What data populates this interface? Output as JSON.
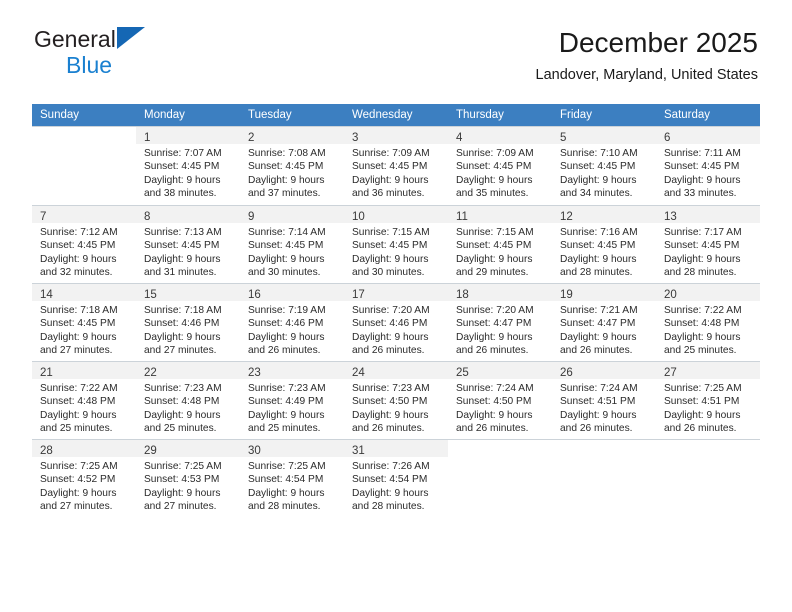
{
  "brand": {
    "name_top": "General",
    "name_bottom": "Blue",
    "triangle_color": "#1567b4",
    "bottom_color": "#1a80d0"
  },
  "header": {
    "title": "December 2025",
    "subtitle": "Landover, Maryland, United States"
  },
  "theme": {
    "header_row_bg": "#3c7fc1",
    "header_row_text": "#ffffff",
    "daynum_bar_bg": "#f2f2f2",
    "grid_line": "#ccd3d9"
  },
  "weekdays": [
    "Sunday",
    "Monday",
    "Tuesday",
    "Wednesday",
    "Thursday",
    "Friday",
    "Saturday"
  ],
  "weeks": [
    [
      {
        "day": "",
        "sunrise": "",
        "sunset": "",
        "daylight_line1": "",
        "daylight_line2": ""
      },
      {
        "day": "1",
        "sunrise": "Sunrise: 7:07 AM",
        "sunset": "Sunset: 4:45 PM",
        "daylight_line1": "Daylight: 9 hours",
        "daylight_line2": "and 38 minutes."
      },
      {
        "day": "2",
        "sunrise": "Sunrise: 7:08 AM",
        "sunset": "Sunset: 4:45 PM",
        "daylight_line1": "Daylight: 9 hours",
        "daylight_line2": "and 37 minutes."
      },
      {
        "day": "3",
        "sunrise": "Sunrise: 7:09 AM",
        "sunset": "Sunset: 4:45 PM",
        "daylight_line1": "Daylight: 9 hours",
        "daylight_line2": "and 36 minutes."
      },
      {
        "day": "4",
        "sunrise": "Sunrise: 7:09 AM",
        "sunset": "Sunset: 4:45 PM",
        "daylight_line1": "Daylight: 9 hours",
        "daylight_line2": "and 35 minutes."
      },
      {
        "day": "5",
        "sunrise": "Sunrise: 7:10 AM",
        "sunset": "Sunset: 4:45 PM",
        "daylight_line1": "Daylight: 9 hours",
        "daylight_line2": "and 34 minutes."
      },
      {
        "day": "6",
        "sunrise": "Sunrise: 7:11 AM",
        "sunset": "Sunset: 4:45 PM",
        "daylight_line1": "Daylight: 9 hours",
        "daylight_line2": "and 33 minutes."
      }
    ],
    [
      {
        "day": "7",
        "sunrise": "Sunrise: 7:12 AM",
        "sunset": "Sunset: 4:45 PM",
        "daylight_line1": "Daylight: 9 hours",
        "daylight_line2": "and 32 minutes."
      },
      {
        "day": "8",
        "sunrise": "Sunrise: 7:13 AM",
        "sunset": "Sunset: 4:45 PM",
        "daylight_line1": "Daylight: 9 hours",
        "daylight_line2": "and 31 minutes."
      },
      {
        "day": "9",
        "sunrise": "Sunrise: 7:14 AM",
        "sunset": "Sunset: 4:45 PM",
        "daylight_line1": "Daylight: 9 hours",
        "daylight_line2": "and 30 minutes."
      },
      {
        "day": "10",
        "sunrise": "Sunrise: 7:15 AM",
        "sunset": "Sunset: 4:45 PM",
        "daylight_line1": "Daylight: 9 hours",
        "daylight_line2": "and 30 minutes."
      },
      {
        "day": "11",
        "sunrise": "Sunrise: 7:15 AM",
        "sunset": "Sunset: 4:45 PM",
        "daylight_line1": "Daylight: 9 hours",
        "daylight_line2": "and 29 minutes."
      },
      {
        "day": "12",
        "sunrise": "Sunrise: 7:16 AM",
        "sunset": "Sunset: 4:45 PM",
        "daylight_line1": "Daylight: 9 hours",
        "daylight_line2": "and 28 minutes."
      },
      {
        "day": "13",
        "sunrise": "Sunrise: 7:17 AM",
        "sunset": "Sunset: 4:45 PM",
        "daylight_line1": "Daylight: 9 hours",
        "daylight_line2": "and 28 minutes."
      }
    ],
    [
      {
        "day": "14",
        "sunrise": "Sunrise: 7:18 AM",
        "sunset": "Sunset: 4:45 PM",
        "daylight_line1": "Daylight: 9 hours",
        "daylight_line2": "and 27 minutes."
      },
      {
        "day": "15",
        "sunrise": "Sunrise: 7:18 AM",
        "sunset": "Sunset: 4:46 PM",
        "daylight_line1": "Daylight: 9 hours",
        "daylight_line2": "and 27 minutes."
      },
      {
        "day": "16",
        "sunrise": "Sunrise: 7:19 AM",
        "sunset": "Sunset: 4:46 PM",
        "daylight_line1": "Daylight: 9 hours",
        "daylight_line2": "and 26 minutes."
      },
      {
        "day": "17",
        "sunrise": "Sunrise: 7:20 AM",
        "sunset": "Sunset: 4:46 PM",
        "daylight_line1": "Daylight: 9 hours",
        "daylight_line2": "and 26 minutes."
      },
      {
        "day": "18",
        "sunrise": "Sunrise: 7:20 AM",
        "sunset": "Sunset: 4:47 PM",
        "daylight_line1": "Daylight: 9 hours",
        "daylight_line2": "and 26 minutes."
      },
      {
        "day": "19",
        "sunrise": "Sunrise: 7:21 AM",
        "sunset": "Sunset: 4:47 PM",
        "daylight_line1": "Daylight: 9 hours",
        "daylight_line2": "and 26 minutes."
      },
      {
        "day": "20",
        "sunrise": "Sunrise: 7:22 AM",
        "sunset": "Sunset: 4:48 PM",
        "daylight_line1": "Daylight: 9 hours",
        "daylight_line2": "and 25 minutes."
      }
    ],
    [
      {
        "day": "21",
        "sunrise": "Sunrise: 7:22 AM",
        "sunset": "Sunset: 4:48 PM",
        "daylight_line1": "Daylight: 9 hours",
        "daylight_line2": "and 25 minutes."
      },
      {
        "day": "22",
        "sunrise": "Sunrise: 7:23 AM",
        "sunset": "Sunset: 4:48 PM",
        "daylight_line1": "Daylight: 9 hours",
        "daylight_line2": "and 25 minutes."
      },
      {
        "day": "23",
        "sunrise": "Sunrise: 7:23 AM",
        "sunset": "Sunset: 4:49 PM",
        "daylight_line1": "Daylight: 9 hours",
        "daylight_line2": "and 25 minutes."
      },
      {
        "day": "24",
        "sunrise": "Sunrise: 7:23 AM",
        "sunset": "Sunset: 4:50 PM",
        "daylight_line1": "Daylight: 9 hours",
        "daylight_line2": "and 26 minutes."
      },
      {
        "day": "25",
        "sunrise": "Sunrise: 7:24 AM",
        "sunset": "Sunset: 4:50 PM",
        "daylight_line1": "Daylight: 9 hours",
        "daylight_line2": "and 26 minutes."
      },
      {
        "day": "26",
        "sunrise": "Sunrise: 7:24 AM",
        "sunset": "Sunset: 4:51 PM",
        "daylight_line1": "Daylight: 9 hours",
        "daylight_line2": "and 26 minutes."
      },
      {
        "day": "27",
        "sunrise": "Sunrise: 7:25 AM",
        "sunset": "Sunset: 4:51 PM",
        "daylight_line1": "Daylight: 9 hours",
        "daylight_line2": "and 26 minutes."
      }
    ],
    [
      {
        "day": "28",
        "sunrise": "Sunrise: 7:25 AM",
        "sunset": "Sunset: 4:52 PM",
        "daylight_line1": "Daylight: 9 hours",
        "daylight_line2": "and 27 minutes."
      },
      {
        "day": "29",
        "sunrise": "Sunrise: 7:25 AM",
        "sunset": "Sunset: 4:53 PM",
        "daylight_line1": "Daylight: 9 hours",
        "daylight_line2": "and 27 minutes."
      },
      {
        "day": "30",
        "sunrise": "Sunrise: 7:25 AM",
        "sunset": "Sunset: 4:54 PM",
        "daylight_line1": "Daylight: 9 hours",
        "daylight_line2": "and 28 minutes."
      },
      {
        "day": "31",
        "sunrise": "Sunrise: 7:26 AM",
        "sunset": "Sunset: 4:54 PM",
        "daylight_line1": "Daylight: 9 hours",
        "daylight_line2": "and 28 minutes."
      },
      {
        "day": "",
        "sunrise": "",
        "sunset": "",
        "daylight_line1": "",
        "daylight_line2": ""
      },
      {
        "day": "",
        "sunrise": "",
        "sunset": "",
        "daylight_line1": "",
        "daylight_line2": ""
      },
      {
        "day": "",
        "sunrise": "",
        "sunset": "",
        "daylight_line1": "",
        "daylight_line2": ""
      }
    ]
  ]
}
